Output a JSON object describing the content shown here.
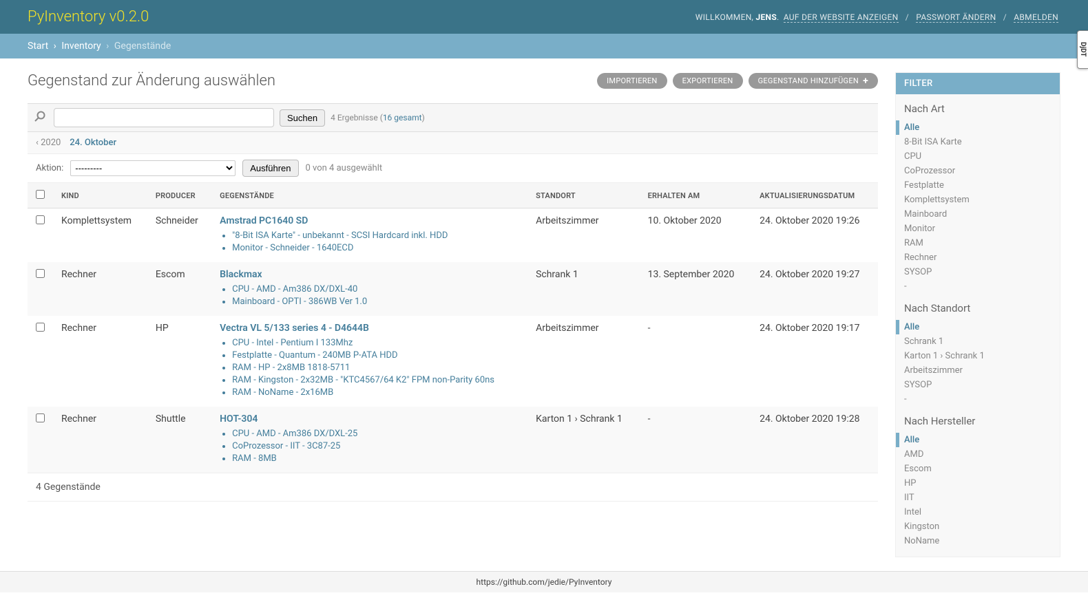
{
  "branding": "PyInventory v0.2.0",
  "usertools": {
    "welcome": "WILLKOMMEN,",
    "username": "JENS",
    "view_site": "AUF DER WEBSITE ANZEIGEN",
    "change_password": "PASSWORT ÄNDERN",
    "logout": "ABMELDEN"
  },
  "breadcrumbs": {
    "start": "Start",
    "app": "Inventory",
    "current": "Gegenstände"
  },
  "page_title": "Gegenstand zur Änderung auswählen",
  "object_tools": {
    "import": "IMPORTIEREN",
    "export": "EXPORTIEREN",
    "add": "GEGENSTAND HINZUFÜGEN"
  },
  "search": {
    "button": "Suchen",
    "count_prefix": "4 Ergebnisse (",
    "count_link": "16 gesamt",
    "count_suffix": ")"
  },
  "date_hierarchy": {
    "back": "‹ 2020",
    "current": "24. Oktober"
  },
  "actions": {
    "label": "Aktion:",
    "placeholder": "---------",
    "go": "Ausführen",
    "count": "0 von 4 ausgewählt"
  },
  "columns": [
    "KIND",
    "PRODUCER",
    "GEGENSTÄNDE",
    "STANDORT",
    "ERHALTEN AM",
    "AKTUALISIERUNGSDATUM"
  ],
  "rows": [
    {
      "kind": "Komplettsystem",
      "producer": "Schneider",
      "name": "Amstrad PC1640 SD",
      "parts": [
        "\"8-Bit ISA Karte\" - unbekannt - SCSI Hardcard inkl. HDD",
        "Monitor - Schneider - 1640ECD"
      ],
      "location": "Arbeitszimmer",
      "received": "10. Oktober 2020",
      "updated": "24. Oktober 2020 19:26"
    },
    {
      "kind": "Rechner",
      "producer": "Escom",
      "name": "Blackmax",
      "parts": [
        "CPU - AMD - Am386 DX/DXL-40",
        "Mainboard - OPTI - 386WB Ver 1.0"
      ],
      "location": "Schrank 1",
      "received": "13. September 2020",
      "updated": "24. Oktober 2020 19:27"
    },
    {
      "kind": "Rechner",
      "producer": "HP",
      "name": "Vectra VL 5/133 series 4 - D4644B",
      "parts": [
        "CPU - Intel - Pentium I 133Mhz",
        "Festplatte - Quantum - 240MB P-ATA HDD",
        "RAM - HP - 2x8MB 1818-5711",
        "RAM - Kingston - 2x32MB - \"KTC4567/64 K2\" FPM non-Parity 60ns",
        "RAM - NoName - 2x16MB"
      ],
      "location": "Arbeitszimmer",
      "received": "-",
      "updated": "24. Oktober 2020 19:17"
    },
    {
      "kind": "Rechner",
      "producer": "Shuttle",
      "name": "HOT-304",
      "parts": [
        "CPU - AMD - Am386 DX/DXL-25",
        "CoProzessor - IIT - 3C87-25",
        "RAM - 8MB"
      ],
      "location": "Karton 1 › Schrank 1",
      "received": "-",
      "updated": "24. Oktober 2020 19:28"
    }
  ],
  "paginator": "4 Gegenstände",
  "filter": {
    "title": "FILTER",
    "groups": [
      {
        "title": "Nach Art",
        "items": [
          "Alle",
          "8-Bit ISA Karte",
          "CPU",
          "CoProzessor",
          "Festplatte",
          "Komplettsystem",
          "Mainboard",
          "Monitor",
          "RAM",
          "Rechner",
          "SYSOP",
          "-"
        ]
      },
      {
        "title": "Nach Standort",
        "items": [
          "Alle",
          "Schrank 1",
          "Karton 1 › Schrank 1",
          "Arbeitszimmer",
          "SYSOP",
          "-"
        ]
      },
      {
        "title": "Nach Hersteller",
        "items": [
          "Alle",
          "AMD",
          "Escom",
          "HP",
          "IIT",
          "Intel",
          "Kingston",
          "NoName"
        ]
      }
    ]
  },
  "footer": "https://github.com/jedie/PyInventory",
  "djdt": "DjDT"
}
